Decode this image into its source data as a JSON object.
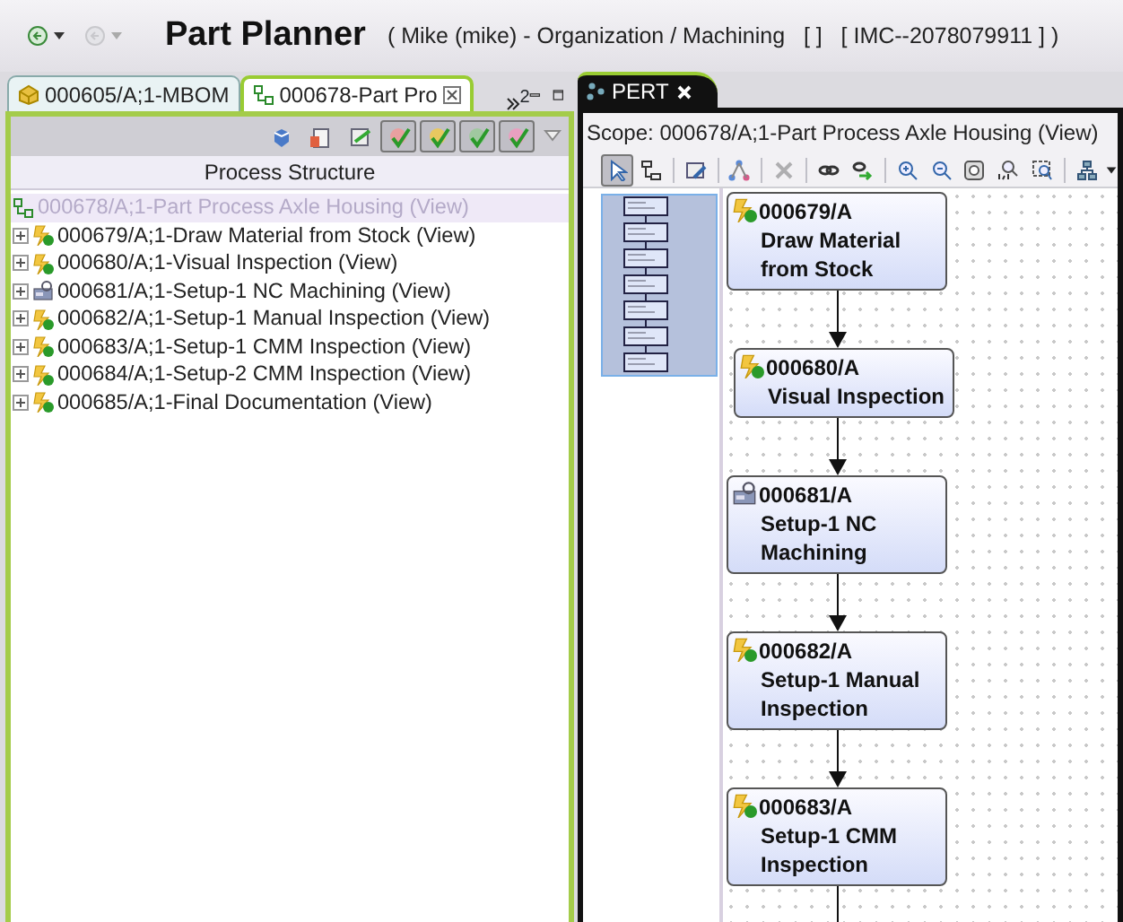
{
  "title_bar": {
    "buttons": [
      {
        "disabled": false
      },
      {
        "disabled": true
      }
    ],
    "title": "Part Planner",
    "context": "( Mike (mike) - Organization / Machining   [ ]   [ IMC--2078079911 ] )"
  },
  "left_panel": {
    "tabs": [
      {
        "label": "000605/A;1-MBOM",
        "selected": false,
        "closable": false
      },
      {
        "label": "000678-Part Pro",
        "selected": true,
        "closable": true
      }
    ],
    "overflow_count": "2",
    "toolbar": [
      {
        "pressed": false
      },
      {
        "pressed": false
      },
      {
        "pressed": false
      },
      {
        "pressed": true
      },
      {
        "pressed": true
      },
      {
        "pressed": true
      },
      {
        "pressed": true
      }
    ],
    "column_header": "Process Structure",
    "tree": [
      {
        "label": "000678/A;1-Part Process Axle Housing (View)",
        "kind": "process",
        "selected": true,
        "children": [
          {
            "label": "000679/A;1-Draw Material from Stock (View)",
            "kind": "operation",
            "selected": false,
            "expanded": false
          },
          {
            "label": "000680/A;1-Visual Inspection (View)",
            "kind": "operation",
            "selected": false,
            "expanded": false
          },
          {
            "label": "000681/A;1-Setup-1 NC Machining (View)",
            "kind": "nc",
            "selected": false,
            "expanded": false
          },
          {
            "label": "000682/A;1-Setup-1 Manual Inspection (View)",
            "kind": "operation",
            "selected": false,
            "expanded": false
          },
          {
            "label": "000683/A;1-Setup-1 CMM Inspection (View)",
            "kind": "operation",
            "selected": false,
            "expanded": false
          },
          {
            "label": "000684/A;1-Setup-2 CMM Inspection (View)",
            "kind": "operation",
            "selected": false,
            "expanded": false
          },
          {
            "label": "000685/A;1-Final Documentation (View)",
            "kind": "operation",
            "selected": false,
            "expanded": false
          }
        ]
      }
    ]
  },
  "right_panel": {
    "tabs": [
      {
        "label": "PERT",
        "selected": true
      }
    ],
    "scope": "Scope: 000678/A;1-Part Process Axle Housing (View)",
    "toolbar": [
      {
        "kind": "select",
        "pressed": true,
        "disabled": false
      },
      {
        "kind": "connect",
        "pressed": false,
        "disabled": false
      },
      {
        "kind": "sep"
      },
      {
        "kind": "edit",
        "pressed": false,
        "disabled": false
      },
      {
        "kind": "sep"
      },
      {
        "kind": "network",
        "pressed": false,
        "disabled": false
      },
      {
        "kind": "sep"
      },
      {
        "kind": "delete",
        "pressed": false,
        "disabled": true
      },
      {
        "kind": "sep"
      },
      {
        "kind": "link",
        "pressed": false,
        "disabled": false
      },
      {
        "kind": "link-go",
        "pressed": false,
        "disabled": false
      },
      {
        "kind": "sep"
      },
      {
        "kind": "zoom-in",
        "pressed": false,
        "disabled": false
      },
      {
        "kind": "zoom-out",
        "pressed": false,
        "disabled": false
      },
      {
        "kind": "fit",
        "pressed": false,
        "disabled": false
      },
      {
        "kind": "actual",
        "pressed": false,
        "disabled": false
      },
      {
        "kind": "zoom-region",
        "pressed": false,
        "disabled": false
      },
      {
        "kind": "sep"
      },
      {
        "kind": "layout",
        "pressed": false,
        "disabled": false
      }
    ],
    "nodes": [
      {
        "number": "000679/A",
        "name_lines": [
          "Draw Material",
          "from Stock"
        ],
        "kind": "operation"
      },
      {
        "number": "000680/A",
        "name_lines": [
          "Visual Inspection"
        ],
        "kind": "operation"
      },
      {
        "number": "000681/A",
        "name_lines": [
          "Setup-1 NC",
          "Machining"
        ],
        "kind": "nc"
      },
      {
        "number": "000682/A",
        "name_lines": [
          "Setup-1 Manual",
          "Inspection"
        ],
        "kind": "operation"
      },
      {
        "number": "000683/A",
        "name_lines": [
          "Setup-1 CMM",
          "Inspection"
        ],
        "kind": "operation"
      }
    ]
  }
}
